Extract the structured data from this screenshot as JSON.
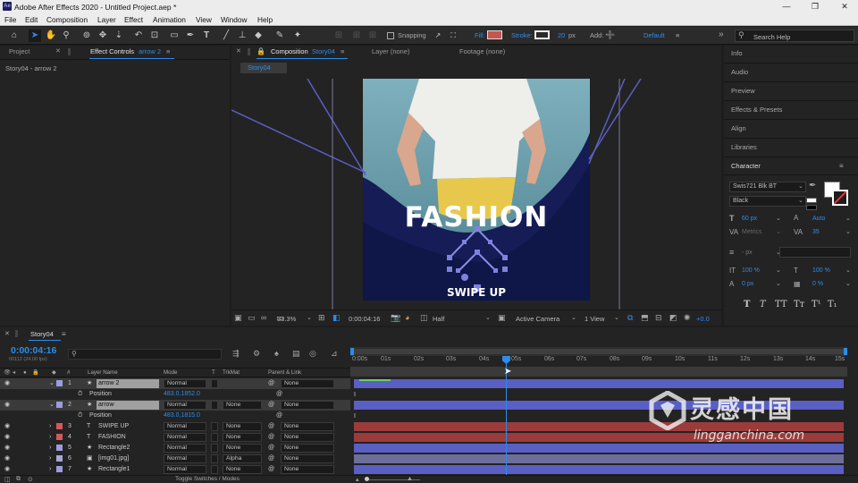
{
  "app": {
    "title": "Adobe After Effects 2020 - Untitled Project.aep *",
    "logo": "Ae"
  },
  "window_controls": {
    "minimize": "—",
    "maximize": "❐",
    "close": "✕"
  },
  "menu": [
    "File",
    "Edit",
    "Composition",
    "Layer",
    "Effect",
    "Animation",
    "View",
    "Window",
    "Help"
  ],
  "toolbar": {
    "snapping": "Snapping",
    "fill": "Fill:",
    "stroke": "Stroke:",
    "stroke_px": "20",
    "px": "px",
    "add": "Add:",
    "workspace": "Default",
    "search_placeholder": "Search Help",
    "icons": [
      "home-icon",
      "selection-tool-icon",
      "hand-tool-icon",
      "zoom-tool-icon",
      "rotate-tool-icon",
      "camera-tool-icon",
      "pan-behind-tool-icon",
      "rectangle-tool-icon",
      "pen-tool-icon",
      "type-tool-icon",
      "brush-tool-icon",
      "clone-stamp-icon",
      "eraser-tool-icon",
      "roto-brush-icon",
      "puppet-pin-icon"
    ]
  },
  "left_panel": {
    "tab_project": "Project",
    "tab_effect_controls": "Effect Controls",
    "effect_target": "arrow 2",
    "breadcrumb": "Story04 - arrow 2"
  },
  "comp_panel": {
    "tab_composition": "Composition",
    "comp_name": "Story04",
    "tab_layer": "Layer (none)",
    "tab_footage": "Footage (none)",
    "sub_tab": "Story04",
    "headline": "FASHION",
    "cta": "SWIPE UP",
    "footer": {
      "zoom": "33.3%",
      "timecode": "0:00:04:16",
      "resolution": "Half",
      "camera": "Active Camera",
      "views": "1 View",
      "exposure": "+0.0"
    }
  },
  "right_panel": {
    "items": [
      "Info",
      "Audio",
      "Preview",
      "Effects & Presets",
      "Align",
      "Libraries",
      "Character"
    ],
    "character": {
      "font": "Swis721 Blk BT",
      "style": "Black",
      "size": "60 px",
      "leading": "Auto",
      "kerning": "Metrics",
      "tracking": "35",
      "stroke_width": "- px",
      "v_scale": "100 %",
      "h_scale": "100 %",
      "baseline": "0 px",
      "tsume": "0 %",
      "styles": [
        "T",
        "T",
        "TT",
        "Tт",
        "T¹",
        "T₁"
      ]
    }
  },
  "timeline": {
    "comp_tab": "Story04",
    "timecode": "0:00:04:16",
    "frames": "00112 (24.00 fps)",
    "search_placeholder": "",
    "columns": {
      "layer_name": "Layer Name",
      "mode": "Mode",
      "t": "T",
      "trkmat": "TrkMat",
      "parent": "Parent & Link"
    },
    "ruler": [
      "0:00s",
      "01s",
      "02s",
      "03s",
      "04s",
      "05s",
      "06s",
      "07s",
      "08s",
      "09s",
      "10s",
      "11s",
      "12s",
      "13s",
      "14s",
      "15s"
    ],
    "bottom_label": "Toggle Switches / Modes",
    "layers": [
      {
        "num": "1",
        "type": "★",
        "name": "arrow 2",
        "mode": "Normal",
        "trkmat": "",
        "parent": "None",
        "color": "#9c9cdf",
        "bar": "#5a5fc4",
        "selected": true
      },
      {
        "num": "",
        "type": "",
        "name": "Position",
        "mode": "483.0,1852.0",
        "trkmat": "",
        "parent": "",
        "color": "",
        "bar": "",
        "prop": true
      },
      {
        "num": "2",
        "type": "★",
        "name": "arrow",
        "mode": "Normal",
        "trkmat": "None",
        "parent": "None",
        "color": "#9c9cdf",
        "bar": "#5a5fc4",
        "selected": true
      },
      {
        "num": "",
        "type": "",
        "name": "Position",
        "mode": "483.0,1815.0",
        "trkmat": "",
        "parent": "",
        "color": "",
        "bar": "",
        "prop": true
      },
      {
        "num": "3",
        "type": "T",
        "name": "SWIPE UP",
        "mode": "Normal",
        "trkmat": "None",
        "parent": "None",
        "color": "#d05a5a",
        "bar": "#9c3b3b"
      },
      {
        "num": "4",
        "type": "T",
        "name": "FASHION",
        "mode": "Normal",
        "trkmat": "None",
        "parent": "None",
        "color": "#d05a5a",
        "bar": "#9c3b3b"
      },
      {
        "num": "5",
        "type": "★",
        "name": "Rectangle2",
        "mode": "Normal",
        "trkmat": "None",
        "parent": "None",
        "color": "#9c9cdf",
        "bar": "#5a5fc4"
      },
      {
        "num": "6",
        "type": "▣",
        "name": "[img01.jpg]",
        "mode": "Normal",
        "trkmat": "Alpha",
        "parent": "None",
        "color": "#a7a7d0",
        "bar": "#6e6e9a"
      },
      {
        "num": "7",
        "type": "★",
        "name": "Rectangle1",
        "mode": "Normal",
        "trkmat": "None",
        "parent": "None",
        "color": "#9c9cdf",
        "bar": "#5a5fc4"
      }
    ]
  },
  "watermark": {
    "cn": "灵感中国",
    "url": "lingganchina.com"
  },
  "colors": {
    "accent": "#2d8ceb",
    "comp_blue": "#151c56",
    "curve": "#5a5fc4"
  }
}
